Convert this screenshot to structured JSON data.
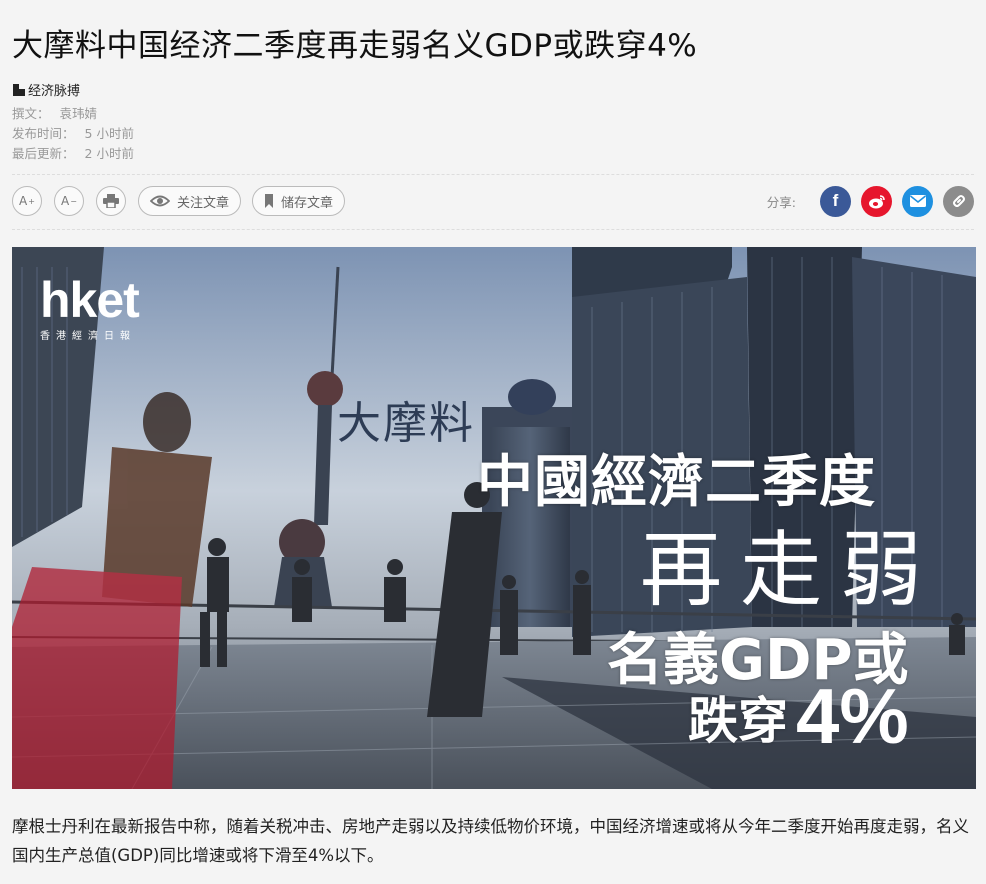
{
  "article": {
    "title": "大摩料中国经济二季度再走弱名义GDP或跌穿4%",
    "column": "经济脉搏",
    "author_label": "撰文：",
    "author": "袁玮婧",
    "published_label": "发布时间：",
    "published": "5 小时前",
    "updated_label": "最后更新：",
    "updated": "2 小时前",
    "body": "摩根士丹利在最新报告中称，随着关税冲击、房地产走弱以及持续低物价环境，中国经济增速或将从今年二季度开始再度走弱，名义国内生产总值(GDP)同比增速或将下滑至4%以下。"
  },
  "toolbar": {
    "font_increase": "A",
    "font_increase_sup": "+",
    "font_decrease": "A",
    "font_decrease_sup": "−",
    "follow_label": "关注文章",
    "save_label": "储存文章",
    "share_label": "分享:"
  },
  "hero": {
    "logo_text": "hket",
    "logo_sub": "香港經濟日報",
    "line1": "大摩料",
    "line2": "中國經濟二季度",
    "line3": "再走弱",
    "line4": "名義GDP或",
    "line5": "跌穿",
    "line6": "4%"
  },
  "icons": {
    "print": "printer-icon",
    "follow": "eye-icon",
    "save": "bookmark-icon",
    "facebook": "facebook-icon",
    "weibo": "weibo-icon",
    "email": "mail-icon",
    "link": "link-icon"
  },
  "colors": {
    "facebook": "#3b5998",
    "weibo": "#e6162d",
    "email": "#1e90e0",
    "link": "#8c8c8c",
    "background": "#f4f4f4"
  }
}
